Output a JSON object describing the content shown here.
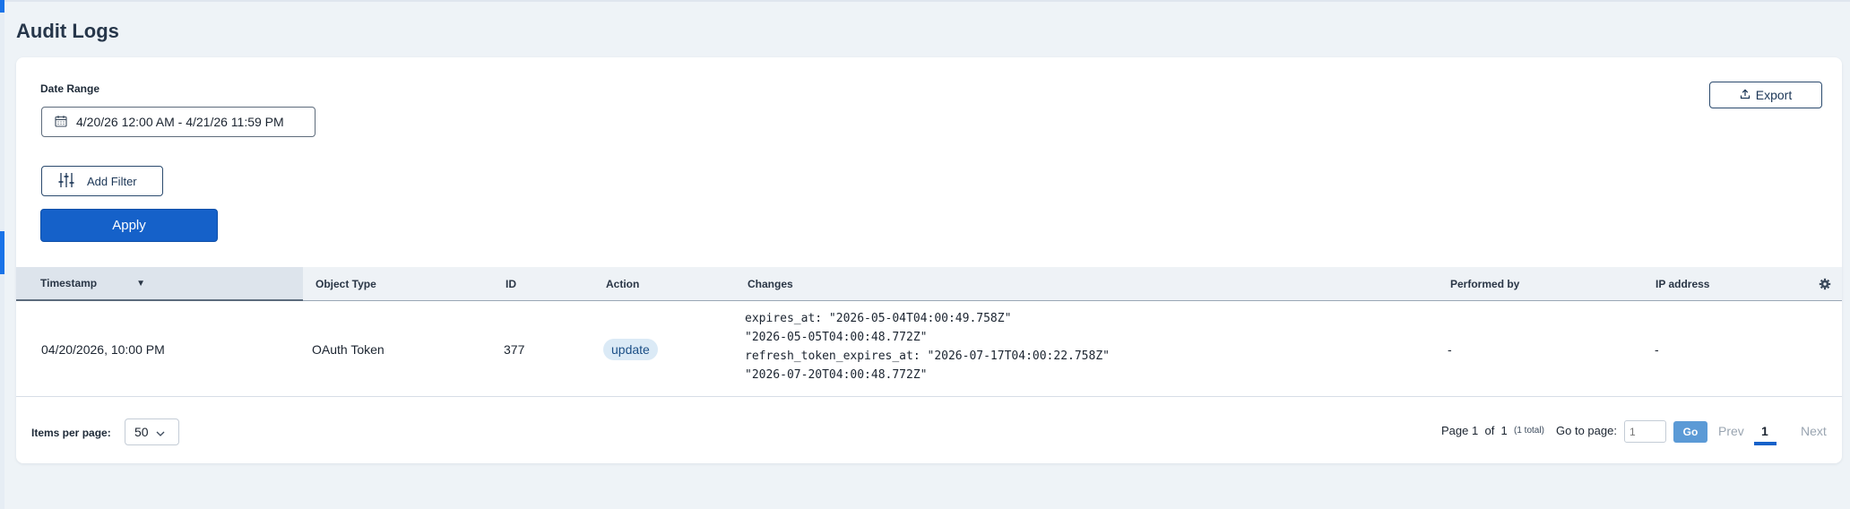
{
  "page": {
    "title": "Audit Logs"
  },
  "filters": {
    "date_range_label": "Date Range",
    "date_range_value": "4/20/26 12:00 AM - 4/21/26 11:59 PM",
    "add_filter_label": "Add Filter",
    "apply_label": "Apply",
    "export_label": "Export"
  },
  "table": {
    "columns": [
      "Timestamp",
      "Object Type",
      "ID",
      "Action",
      "Changes",
      "Performed by",
      "IP address"
    ],
    "sorted_column": "Timestamp",
    "sort_direction": "descending",
    "rows": [
      {
        "timestamp": "04/20/2026, 10:00 PM",
        "object_type": "OAuth Token",
        "id": "377",
        "action": "update",
        "changes": [
          "expires_at: \"2026-05-04T04:00:49.758Z\"",
          "\"2026-05-05T04:00:48.772Z\"",
          "refresh_token_expires_at: \"2026-07-17T04:00:22.758Z\"",
          "\"2026-07-20T04:00:48.772Z\""
        ],
        "performed_by": "-",
        "ip_address": "-"
      }
    ]
  },
  "pagination": {
    "items_per_page_label": "Items per page:",
    "items_per_page_value": "50",
    "page_label": "Page",
    "current_page": "1",
    "of_label": "of",
    "total_pages": "1",
    "total_note": "(1 total)",
    "go_to_label": "Go to page:",
    "go_to_placeholder": "1",
    "go_label": "Go",
    "prev_label": "Prev",
    "next_label": "Next"
  },
  "colors": {
    "primary": "#1561c9",
    "badge_bg": "#dbeaf6",
    "header_bg": "#eef2f6",
    "page_bg": "#eef3f7"
  }
}
